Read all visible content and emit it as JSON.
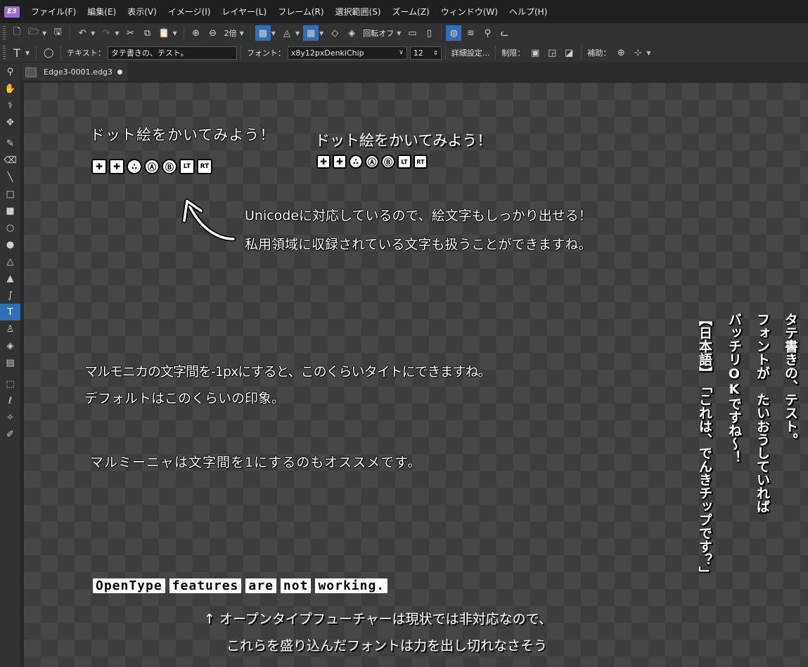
{
  "menubar": {
    "logo": "E3",
    "items": [
      "ファイル(F)",
      "編集(E)",
      "表示(V)",
      "イメージ(I)",
      "レイヤー(L)",
      "フレーム(R)",
      "選択範囲(S)",
      "ズーム(Z)",
      "ウィンドウ(W)",
      "ヘルプ(H)"
    ]
  },
  "toolbar1": {
    "zoom_value": "2倍",
    "rotate_label": "回転オフ"
  },
  "toolbar2": {
    "text_label": "テキスト：",
    "text_value": "タテ書きの、テスト。",
    "font_label": "フォント：",
    "font_value": "x8y12pxDenkiChip",
    "size_value": "12",
    "details_label": "詳細設定...",
    "limit_label": "制限：",
    "assist_label": "補助："
  },
  "tab": {
    "filename": "Edge3-0001.edg3"
  },
  "canvas": {
    "heading_a": "ドット絵をかいてみよう！",
    "heading_b": "ドット絵をかいてみよう！",
    "symbols_a": [
      "✚",
      "✚",
      "∴",
      "Ⓐ",
      "Ⓑ",
      "LT",
      "RT"
    ],
    "symbols_b": [
      "✚",
      "✚",
      "∴",
      "Ⓐ",
      "Ⓑ",
      "LT",
      "RT"
    ],
    "unicode_line1": "Unicodeに対応しているので、絵文字もしっかり出せる！",
    "unicode_line2": "私用領域に収録されている文字も扱うことができますね。",
    "marumonica_line1": "マルモニカの文字間を-1pxにすると、このくらいタイトにできますね。",
    "marumonica_line2": "デフォルトはこのくらいの印象。",
    "maruminya_line": "マルミーニャは文字間を1にするのもオススメです。",
    "opentype_words": [
      "OpenType",
      "features",
      "are",
      "not",
      "working."
    ],
    "opentype_note1": "↑ オープンタイプフューチャーは現状では非対応なので、",
    "opentype_note2": "これらを盛り込んだフォントは力を出し切れなさそう",
    "vertical_cols": [
      "タテ書きの、テスト。",
      "フォントが　たいおうしていれば",
      "バッチリOKですね～！",
      "【日本語】　「これは、でんきチップです？」"
    ]
  }
}
